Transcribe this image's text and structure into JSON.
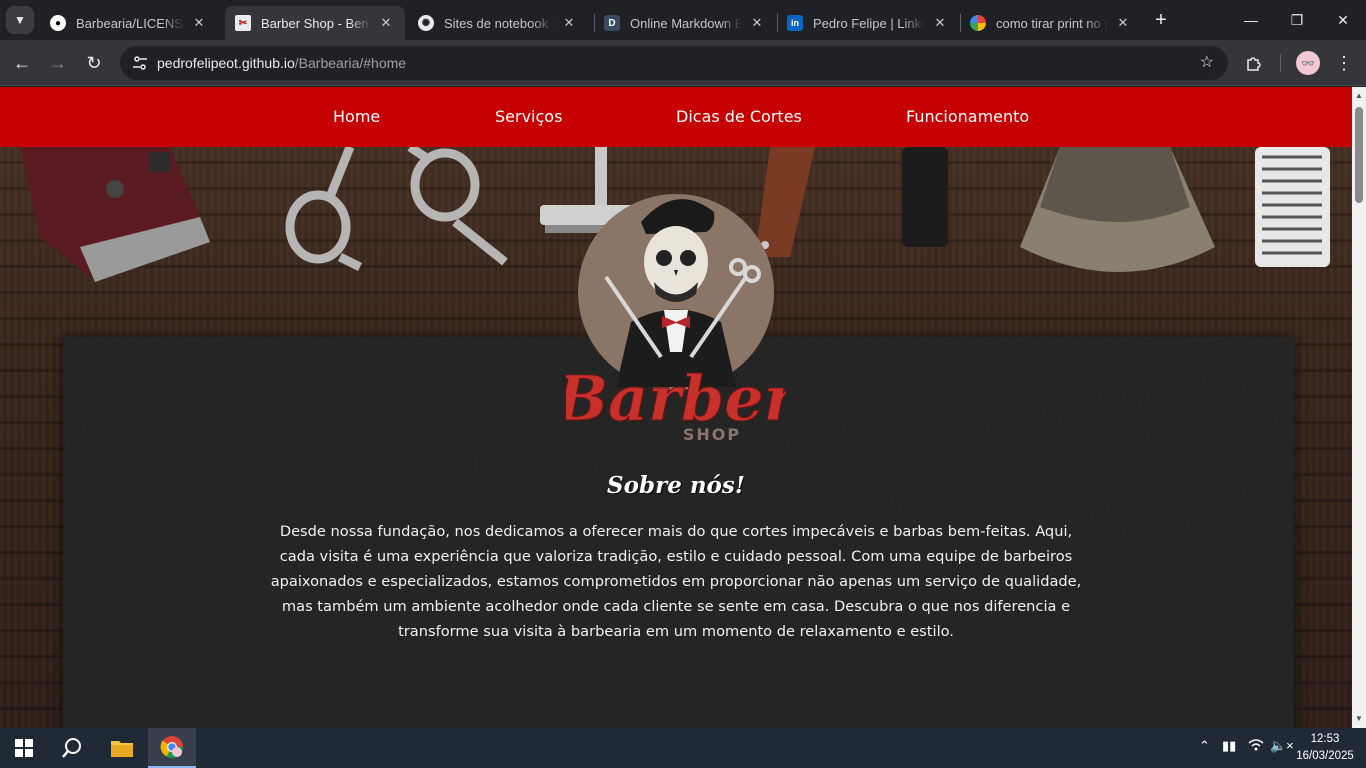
{
  "browser": {
    "tabs": [
      {
        "title": "Barbearia/LICENSE at main",
        "icon": "github-icon",
        "active": false
      },
      {
        "title": "Barber Shop - Bem-vindo",
        "icon": "barber-favicon-icon",
        "active": true
      },
      {
        "title": "Sites de notebook usados",
        "icon": "chatgpt-icon",
        "active": false
      },
      {
        "title": "Online Markdown Editor",
        "icon": "dillinger-icon",
        "active": false
      },
      {
        "title": "Pedro Felipe | LinkedIn",
        "icon": "linkedin-icon",
        "active": false
      },
      {
        "title": "como tirar print no pc",
        "icon": "google-icon",
        "active": false
      }
    ],
    "url_host": "pedrofelipeot.github.io",
    "url_path": "/Barbearia/#home"
  },
  "nav": {
    "items": [
      "Home",
      "Serviços",
      "Dicas de Cortes",
      "Funcionamento"
    ]
  },
  "logo": {
    "word": "Barber",
    "sub": "SHOP"
  },
  "about": {
    "title": "Sobre nós!",
    "text": "Desde nossa fundação, nos dedicamos a oferecer mais do que cortes impecáveis e barbas bem-feitas. Aqui, cada visita é uma experiência que valoriza tradição, estilo e cuidado pessoal. Com uma equipe de barbeiros apaixonados e especializados, estamos comprometidos em proporcionar não apenas um serviço de qualidade, mas também um ambiente acolhedor onde cada cliente se sente em casa. Descubra o que nos diferencia e transforme sua visita à barbearia em um momento de relaxamento e estilo."
  },
  "taskbar": {
    "time": "12:53",
    "date": "16/03/2025"
  },
  "colors": {
    "nav_red": "#c60000",
    "card_bg": "#242424",
    "logo_red": "#c8302b"
  }
}
